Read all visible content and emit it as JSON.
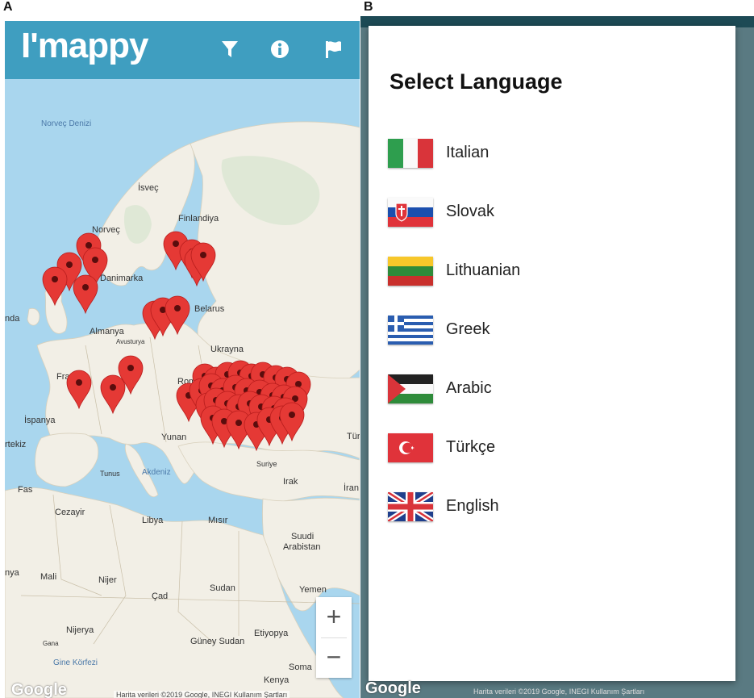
{
  "panel_labels": {
    "a": "A",
    "b": "B"
  },
  "app": {
    "title": "I'mappy"
  },
  "toolbar": {
    "filter_icon": "filter-icon",
    "info_icon": "info-icon",
    "flag_icon": "flag-icon"
  },
  "map": {
    "labels": {
      "norvec_denizi": "Norveç Denizi",
      "isvec": "İsveç",
      "finlandiya": "Finlandiya",
      "norvec": "Norveç",
      "danimarka": "Danimarka",
      "belarus": "Belarus",
      "almanya": "Almanya",
      "avusturya": "Avusturya",
      "ukrayna": "Ukrayna",
      "fransa": "Fransa",
      "romanya": "Rom",
      "ispanya": "İspanya",
      "portekiz": "rtekiz",
      "yunanistan": "Yunan",
      "akdeniz": "Akdeniz",
      "tunus": "Tunus",
      "suriye": "Suriye",
      "irak": "Irak",
      "iran": "İran",
      "turkiye": "Türk",
      "fas": "Fas",
      "cezayir": "Cezayir",
      "libya": "Libya",
      "misir": "Mısır",
      "suudi_arabistan_1": "Suudi",
      "suudi_arabistan_2": "Arabistan",
      "mali": "Mali",
      "nijer": "Nijer",
      "cad": "Çad",
      "sudan": "Sudan",
      "yemen": "Yemen",
      "nijerya": "Nijerya",
      "guney_sudan": "Güney Sudan",
      "etiyopya": "Etiyopya",
      "gana": "Gana",
      "gine_korfezi": "Gine Körfezi",
      "kenya": "Kenya",
      "somali": "Soma",
      "irlanda": "nda",
      "mauritanya": "nya"
    },
    "zoom_in": "+",
    "zoom_out": "−",
    "google_logo": "Google",
    "attribution": "Harita verileri ©2019 Google, INEGI   Kullanım Şartları"
  },
  "language_dialog": {
    "title": "Select Language",
    "languages": [
      {
        "label": "Italian",
        "flag": "italy-flag"
      },
      {
        "label": "Slovak",
        "flag": "slovakia-flag"
      },
      {
        "label": "Lithuanian",
        "flag": "lithuania-flag"
      },
      {
        "label": "Greek",
        "flag": "greece-flag"
      },
      {
        "label": "Arabic",
        "flag": "palestine-flag"
      },
      {
        "label": "Türkçe",
        "flag": "turkey-flag"
      },
      {
        "label": "English",
        "flag": "uk-flag"
      }
    ]
  },
  "colors": {
    "appbar": "#3f9ec0",
    "marker": "#e53935",
    "sea": "#a9d6ee",
    "land": "#f2efe6"
  }
}
